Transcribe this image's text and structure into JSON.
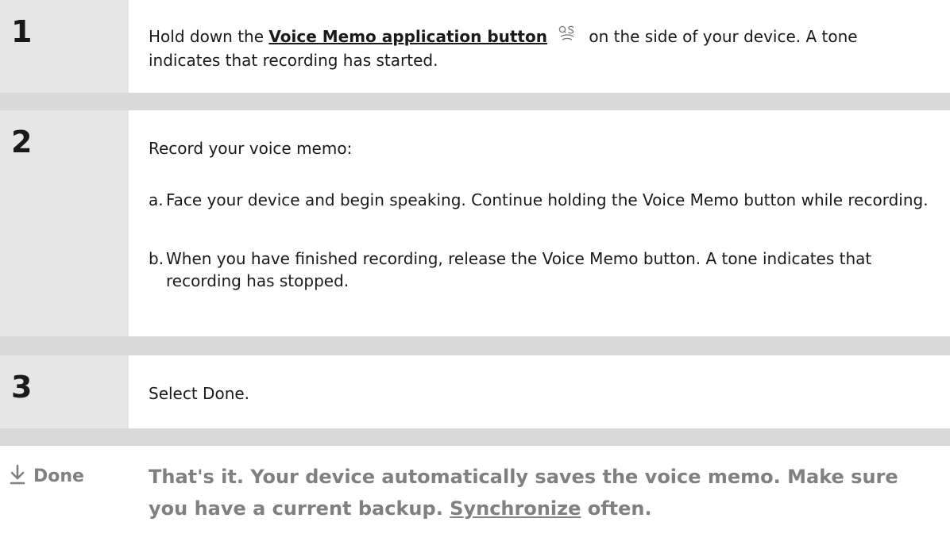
{
  "steps": [
    {
      "number": "1",
      "text_before": "Hold down the ",
      "link": "Voice Memo application button",
      "text_after": " on the side of your device. A tone indicates that recording has started."
    },
    {
      "number": "2",
      "intro": "Record your voice memo:",
      "items": [
        {
          "label": "a.",
          "text": "Face your device and begin speaking. Continue holding the Voice Memo button while recording."
        },
        {
          "label": "b.",
          "text": "When you have finished recording, release the Voice Memo button. A tone indicates that recording has stopped."
        }
      ]
    },
    {
      "number": "3",
      "text": "Select Done."
    }
  ],
  "done": {
    "label": "Done",
    "text_before": "That's it. Your device automatically saves the voice memo. Make sure you have a current backup. ",
    "link": "Synchronize",
    "text_after": " often."
  },
  "icons": {
    "voice_memo": "voice-memo-icon",
    "done_arrow": "down-arrow-icon"
  },
  "colors": {
    "step_bar": "#e6e6e6",
    "separator": "#d9d9d9",
    "done_text": "#808080"
  }
}
